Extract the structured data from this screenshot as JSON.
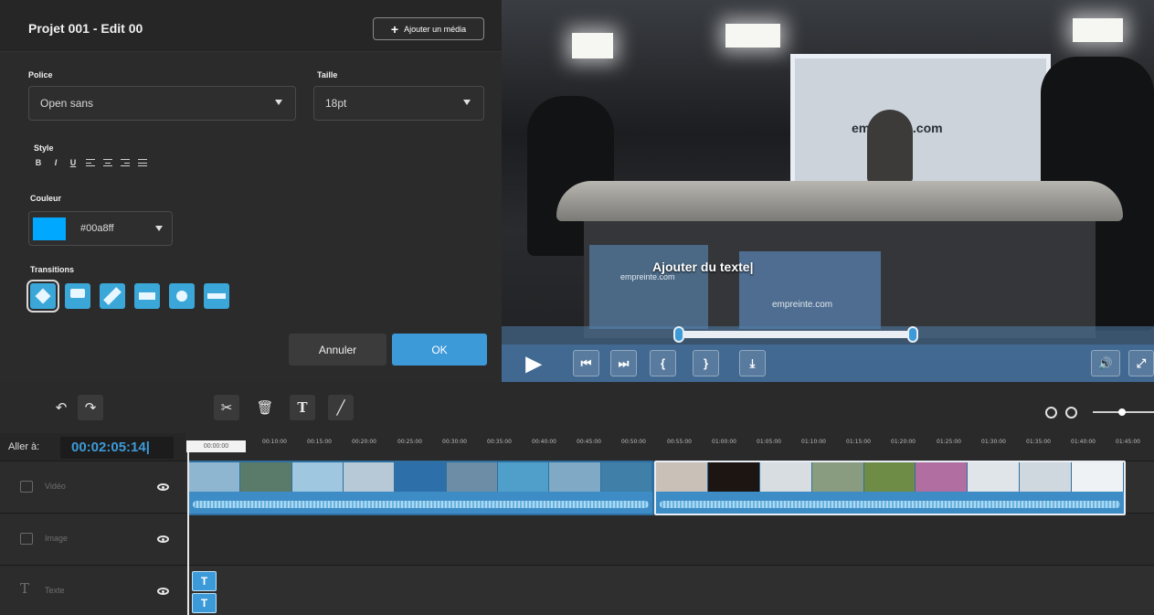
{
  "panel": {
    "title": "Projet 001 - Edit 00",
    "add_media_label": "Ajouter un média",
    "font_label": "Police",
    "font_value": "Open sans",
    "size_label": "Taille",
    "size_value": "18pt",
    "style_label": "Style",
    "style_buttons": [
      "B",
      "I",
      "U"
    ],
    "color_label": "Couleur",
    "color_value": "#00a8ff",
    "transitions_label": "Transitions",
    "cancel_label": "Annuler",
    "ok_label": "OK"
  },
  "preview": {
    "overlay_text": "Ajouter du texte|",
    "screen_brand": "empreinte.com",
    "desk_brand_left": "empreinte.com",
    "desk_brand_right": "empreinte.com"
  },
  "timeline": {
    "goto_label": "Aller à:",
    "goto_value": "00:02:05:14|",
    "playhead_time": "00:00:00",
    "ticks": [
      "00:10:00",
      "00:15:00",
      "00:20:00",
      "00:25:00",
      "00:30:00",
      "00:35:00",
      "00:40:00",
      "00:45:00",
      "00:50:00",
      "00:55:00",
      "01:00:00",
      "01:05:00",
      "01:10:00",
      "01:15:00",
      "01:20:00",
      "01:25:00",
      "01:30:00",
      "01:35:00",
      "01:40:00",
      "01:45:00"
    ],
    "tracks": [
      {
        "name": "Vidéo",
        "icon": "film-icon"
      },
      {
        "name": "Image",
        "icon": "image-icon"
      },
      {
        "name": "Texte",
        "icon": "text-icon"
      }
    ],
    "text_clip_label": "T"
  },
  "colors": {
    "accent": "#3d9ad9",
    "swatch": "#00a8ff",
    "panel_bg": "#2b2b2b",
    "clip_blue": "#3d8cc6"
  }
}
